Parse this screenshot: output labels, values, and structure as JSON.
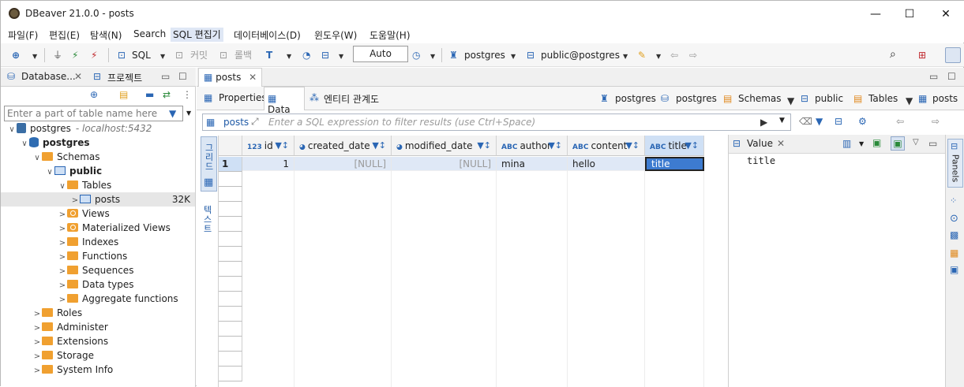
{
  "window": {
    "title": "DBeaver 21.0.0 - posts",
    "minimize": "—",
    "maximize": "☐",
    "close": "✕"
  },
  "menu": [
    "파일(F)",
    "편집(E)",
    "탐색(N)",
    "Search",
    "SQL 편집기",
    "데이터베이스(D)",
    "윈도우(W)",
    "도움말(H)"
  ],
  "toolbar": {
    "sql": "SQL",
    "commit": "커밋",
    "rollback": "롤백",
    "tx_mode": "Auto",
    "datasource": "postgres",
    "schema": "public@postgres"
  },
  "left": {
    "tab_db": "Database...",
    "tab_project": "프로젝트",
    "filter_placeholder": "Enter a part of table name here",
    "tree": [
      {
        "label": "postgres",
        "sub": "- localhost:5432",
        "kind": "conn",
        "indent": 0,
        "expand": "∨"
      },
      {
        "label": "postgres",
        "kind": "db",
        "indent": 1,
        "expand": "∨",
        "bold": true
      },
      {
        "label": "Schemas",
        "kind": "folder",
        "indent": 2,
        "expand": "∨"
      },
      {
        "label": "public",
        "kind": "schema",
        "indent": 3,
        "expand": "∨",
        "bold": true
      },
      {
        "label": "Tables",
        "kind": "folder",
        "indent": 4,
        "expand": "∨"
      },
      {
        "label": "posts",
        "kind": "table",
        "indent": 5,
        "expand": ">",
        "size": "32K",
        "selected": true
      },
      {
        "label": "Views",
        "kind": "eye",
        "indent": 4,
        "expand": ">"
      },
      {
        "label": "Materialized Views",
        "kind": "eye",
        "indent": 4,
        "expand": ">"
      },
      {
        "label": "Indexes",
        "kind": "folder",
        "indent": 4,
        "expand": ">"
      },
      {
        "label": "Functions",
        "kind": "folder",
        "indent": 4,
        "expand": ">"
      },
      {
        "label": "Sequences",
        "kind": "folder",
        "indent": 4,
        "expand": ">"
      },
      {
        "label": "Data types",
        "kind": "folder",
        "indent": 4,
        "expand": ">"
      },
      {
        "label": "Aggregate functions",
        "kind": "folder",
        "indent": 4,
        "expand": ">"
      },
      {
        "label": "Roles",
        "kind": "folder",
        "indent": 2,
        "expand": ">"
      },
      {
        "label": "Administer",
        "kind": "folder",
        "indent": 2,
        "expand": ">"
      },
      {
        "label": "Extensions",
        "kind": "folder",
        "indent": 2,
        "expand": ">"
      },
      {
        "label": "Storage",
        "kind": "folder",
        "indent": 2,
        "expand": ">"
      },
      {
        "label": "System Info",
        "kind": "folder",
        "indent": 2,
        "expand": ">"
      }
    ]
  },
  "editor": {
    "tab": "posts",
    "subtabs": [
      "Properties",
      "Data",
      "엔티티 관계도"
    ],
    "breadcrumbs": [
      "postgres",
      "postgres",
      "Schemas",
      "public",
      "Tables",
      "posts"
    ],
    "filter_label": "posts",
    "filter_placeholder": "Enter a SQL expression to filter results (use Ctrl+Space)",
    "side_tabs": [
      "그리드",
      "텍스트"
    ],
    "columns": [
      {
        "type": "123",
        "name": "id"
      },
      {
        "type": "clock",
        "name": "created_date"
      },
      {
        "type": "clock",
        "name": "modified_date"
      },
      {
        "type": "ABC",
        "name": "author"
      },
      {
        "type": "ABC",
        "name": "content"
      },
      {
        "type": "ABC",
        "name": "title"
      }
    ],
    "rows": [
      {
        "num": "1",
        "cells": [
          "1",
          "[NULL]",
          "[NULL]",
          "mina",
          "hello",
          "title"
        ]
      }
    ]
  },
  "value_panel": {
    "title": "Value",
    "content": "title"
  },
  "panels_label": "Panels"
}
